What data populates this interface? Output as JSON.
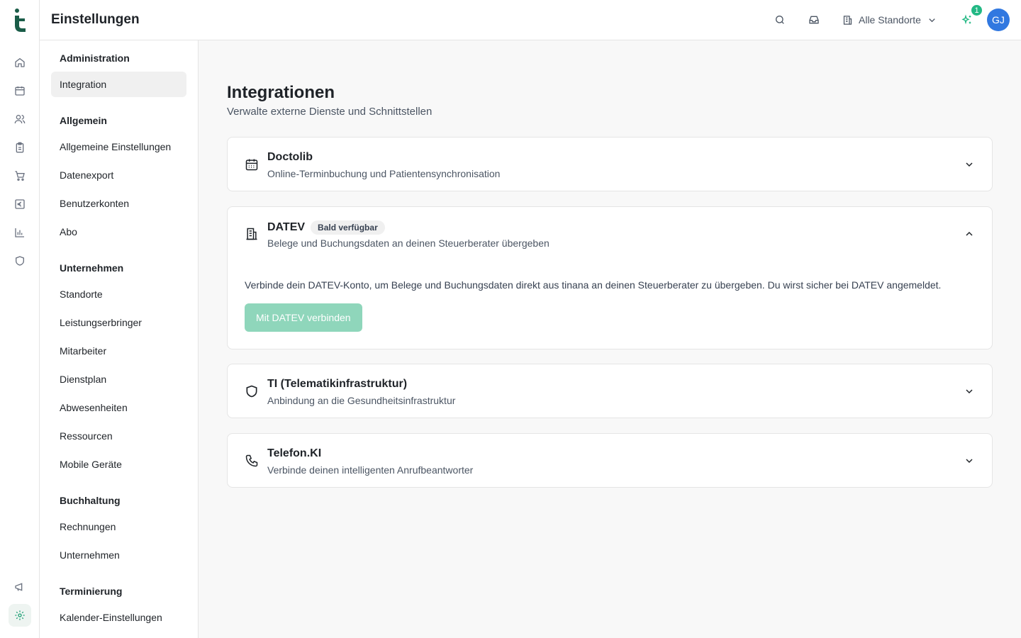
{
  "app": {
    "title": "Einstellungen"
  },
  "rail": {
    "icons": [
      "home-icon",
      "calendar-icon",
      "users-icon",
      "clipboard-icon",
      "cart-icon",
      "euro-icon",
      "chart-icon",
      "shield-icon",
      "megaphone-icon",
      "settings-icon"
    ],
    "active": "settings-icon"
  },
  "topbar": {
    "location_label": "Alle Standorte",
    "notification_count": "1",
    "avatar_initials": "GJ"
  },
  "nav": {
    "sections": [
      {
        "title": "Administration",
        "items": [
          "Integration"
        ]
      },
      {
        "title": "Allgemein",
        "items": [
          "Allgemeine Einstellungen",
          "Datenexport",
          "Benutzerkonten",
          "Abo"
        ]
      },
      {
        "title": "Unternehmen",
        "items": [
          "Standorte",
          "Leistungserbringer",
          "Mitarbeiter",
          "Dienstplan",
          "Abwesenheiten",
          "Ressourcen",
          "Mobile Geräte"
        ]
      },
      {
        "title": "Buchhaltung",
        "items": [
          "Rechnungen",
          "Unternehmen"
        ]
      },
      {
        "title": "Terminierung",
        "items": [
          "Kalender-Einstellungen"
        ]
      }
    ],
    "active_item": "Integration"
  },
  "main": {
    "title": "Integrationen",
    "subtitle": "Verwalte externe Dienste und Schnittstellen",
    "cards": [
      {
        "title": "Doctolib",
        "description": "Online-Terminbuchung und Patientensynchronisation",
        "icon": "calendar-icon",
        "expanded": false
      },
      {
        "title": "DATEV",
        "badge": "Bald verfügbar",
        "description": "Belege und Buchungsdaten an deinen Steuerberater übergeben",
        "icon": "building-icon",
        "expanded": true,
        "body_text": "Verbinde dein DATEV-Konto, um Belege und Buchungsdaten direkt aus tinana an deinen Steuerberater zu übergeben. Du wirst sicher bei DATEV angemeldet.",
        "button_label": "Mit DATEV verbinden"
      },
      {
        "title": "TI (Telematikinfrastruktur)",
        "description": "Anbindung an die Gesundheitsinfrastruktur",
        "icon": "shield-icon",
        "expanded": false
      },
      {
        "title": "Telefon.KI",
        "description": "Verbinde deinen intelligenten Anrufbeantworter",
        "icon": "phone-icon",
        "expanded": false
      }
    ]
  },
  "colors": {
    "brand": "#1a5c48",
    "accent": "#23b884",
    "button_disabled": "#8fd6bb",
    "avatar": "#3178e0"
  }
}
